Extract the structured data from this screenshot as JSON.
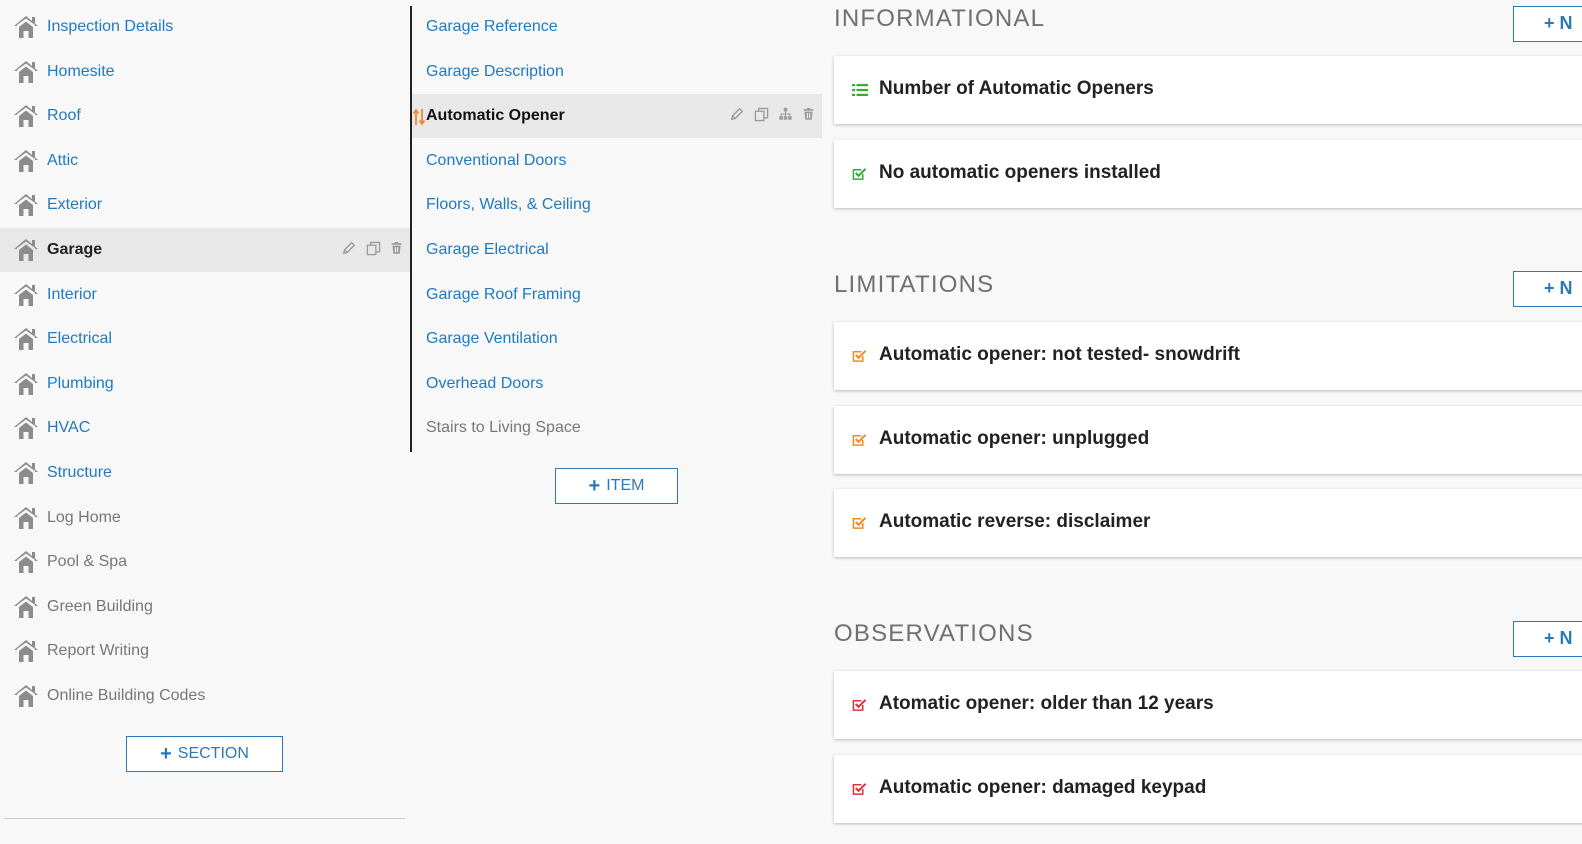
{
  "sections": {
    "items": [
      {
        "label": "Inspection Details",
        "state": "link"
      },
      {
        "label": "Homesite",
        "state": "link"
      },
      {
        "label": "Roof",
        "state": "link"
      },
      {
        "label": "Attic",
        "state": "link"
      },
      {
        "label": "Exterior",
        "state": "link"
      },
      {
        "label": "Garage",
        "state": "active"
      },
      {
        "label": "Interior",
        "state": "link"
      },
      {
        "label": "Electrical",
        "state": "link"
      },
      {
        "label": "Plumbing",
        "state": "link"
      },
      {
        "label": "HVAC",
        "state": "link"
      },
      {
        "label": "Structure",
        "state": "link"
      },
      {
        "label": "Log Home",
        "state": "inactive"
      },
      {
        "label": "Pool & Spa",
        "state": "inactive"
      },
      {
        "label": "Green Building",
        "state": "inactive"
      },
      {
        "label": "Report Writing",
        "state": "inactive"
      },
      {
        "label": "Online Building Codes",
        "state": "inactive"
      }
    ],
    "add_label": "SECTION"
  },
  "items": {
    "list": [
      {
        "label": "Garage Reference",
        "state": "link"
      },
      {
        "label": "Garage Description",
        "state": "link"
      },
      {
        "label": "Automatic Opener",
        "state": "active"
      },
      {
        "label": "Conventional Doors",
        "state": "link"
      },
      {
        "label": "Floors, Walls, & Ceiling",
        "state": "link"
      },
      {
        "label": "Garage Electrical",
        "state": "link"
      },
      {
        "label": "Garage Roof Framing",
        "state": "link"
      },
      {
        "label": "Garage Ventilation",
        "state": "link"
      },
      {
        "label": "Overhead Doors",
        "state": "link"
      },
      {
        "label": "Stairs to Living Space",
        "state": "inactive"
      }
    ],
    "add_label": "ITEM"
  },
  "comments": {
    "informational": {
      "title": "INFORMATIONAL",
      "add_label": "N",
      "cards": [
        {
          "text": "Number of Automatic Openers",
          "icon": "list-icon",
          "color": "#3aaa35"
        },
        {
          "text": "No automatic openers installed",
          "icon": "checkbox-icon",
          "color": "#3aaa35"
        }
      ]
    },
    "limitations": {
      "title": "LIMITATIONS",
      "add_label": "N",
      "cards": [
        {
          "text": "Automatic opener: not tested- snowdrift",
          "icon": "checkbox-icon",
          "color": "#f08a24"
        },
        {
          "text": "Automatic opener: unplugged",
          "icon": "checkbox-icon",
          "color": "#f08a24"
        },
        {
          "text": "Automatic reverse: disclaimer",
          "icon": "checkbox-icon",
          "color": "#f08a24"
        }
      ]
    },
    "observations": {
      "title": "OBSERVATIONS",
      "add_label": "N",
      "cards": [
        {
          "text": "Atomatic opener: older than 12 years",
          "icon": "checkbox-icon",
          "color": "#e0313b"
        },
        {
          "text": "Automatic opener: damaged keypad",
          "icon": "checkbox-icon",
          "color": "#e0313b"
        }
      ]
    }
  },
  "colors": {
    "link": "#1f7ac2",
    "accent": "#2a7ab8",
    "drag": "#f08a24"
  }
}
